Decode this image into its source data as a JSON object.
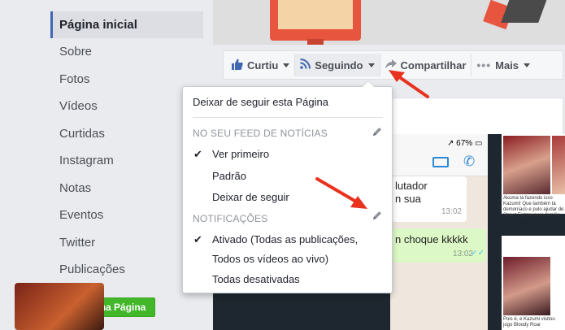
{
  "sidebar": {
    "items": [
      {
        "label": "Página inicial",
        "active": true
      },
      {
        "label": "Sobre"
      },
      {
        "label": "Fotos"
      },
      {
        "label": "Vídeos"
      },
      {
        "label": "Curtidas"
      },
      {
        "label": "Instagram"
      },
      {
        "label": "Notas"
      },
      {
        "label": "Eventos"
      },
      {
        "label": "Twitter"
      },
      {
        "label": "Publicações"
      }
    ],
    "create_button": "Criar uma Página"
  },
  "action_bar": {
    "like_label": "Curtiu",
    "like_icon": "thumbs-up-icon",
    "following_label": "Seguindo",
    "following_icon": "rss-icon",
    "share_label": "Compartilhar",
    "share_icon": "share-arrow-icon",
    "more_label": "Mais",
    "more_icon": "ellipsis-icon"
  },
  "dropdown": {
    "unfollow_page": "Deixar de seguir esta Página",
    "feed_header": "NO SEU FEED DE NOTÍCIAS",
    "feed_options": [
      {
        "label": "Ver primeiro",
        "checked": true
      },
      {
        "label": "Padrão",
        "checked": false
      },
      {
        "label": "Deixar de seguir",
        "checked": false
      }
    ],
    "notifications_header": "NOTIFICAÇÕES",
    "notification_options": [
      {
        "label_line1": "Ativado (Todas as publicações,",
        "label_line2": "Todos os vídeos ao vivo)",
        "checked": true
      },
      {
        "label_line1": "Todas desativadas",
        "checked": false
      }
    ]
  },
  "post_preview": {
    "battery": "67%",
    "bubble1_line1": "lutador",
    "bubble1_line2": "n sua",
    "bubble1_time": "13:02",
    "bubble2_text": "n choque kkkkk",
    "bubble2_time": "13:02",
    "caption_top": "Akuma tá fazendo isso Kazumi! Que também tá demoníaco e pulo ajudar de Street Fighter para família",
    "caption_bottom": "Pois é, e Kazumi visitou jogo Bloody Roar"
  },
  "colors": {
    "accent": "#4267b2",
    "create_button": "#42b72a",
    "arrow": "#e8321f"
  }
}
